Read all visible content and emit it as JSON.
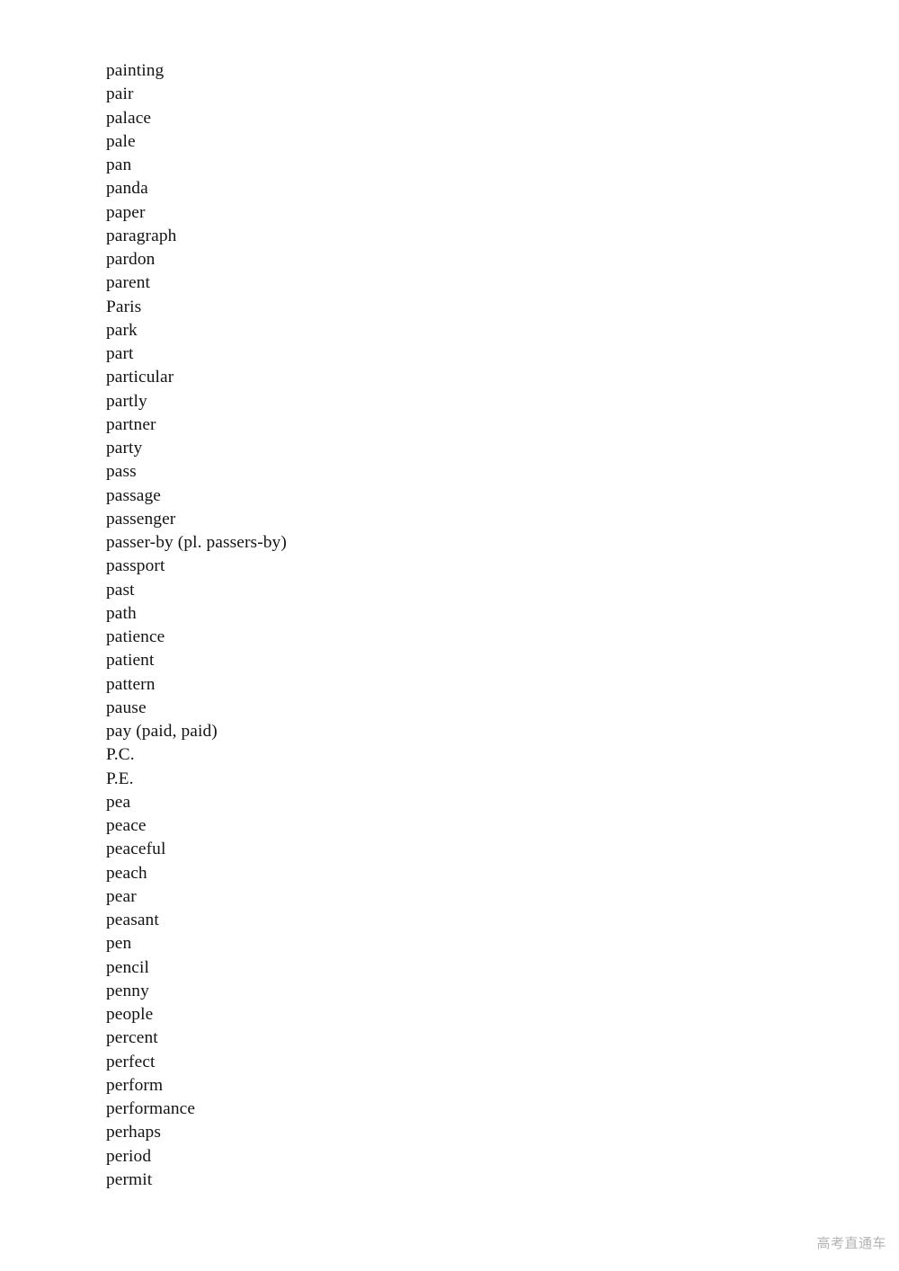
{
  "document": {
    "kind": "vocabulary-word-list",
    "background_color": "#ffffff",
    "text_color": "#141414",
    "words": [
      "painting",
      "pair",
      "palace",
      "pale",
      "pan",
      "panda",
      "paper",
      "paragraph",
      "pardon",
      "parent",
      "Paris",
      "park",
      "part",
      "particular",
      "partly",
      "partner",
      "party",
      "pass",
      "passage",
      "passenger",
      "passer-by (pl. passers-by)",
      "passport",
      "past",
      "path",
      "patience",
      "patient",
      "pattern",
      "pause",
      "pay (paid, paid)",
      "P.C.",
      "P.E.",
      "pea",
      "peace",
      "peaceful",
      "peach",
      "pear",
      "peasant",
      "pen",
      "pencil",
      "penny",
      "people",
      "percent",
      "perfect",
      "perform",
      "performance",
      "perhaps",
      "period",
      "permit"
    ]
  },
  "watermark": {
    "text": "高考直通车",
    "color": "#b3b3b3"
  }
}
